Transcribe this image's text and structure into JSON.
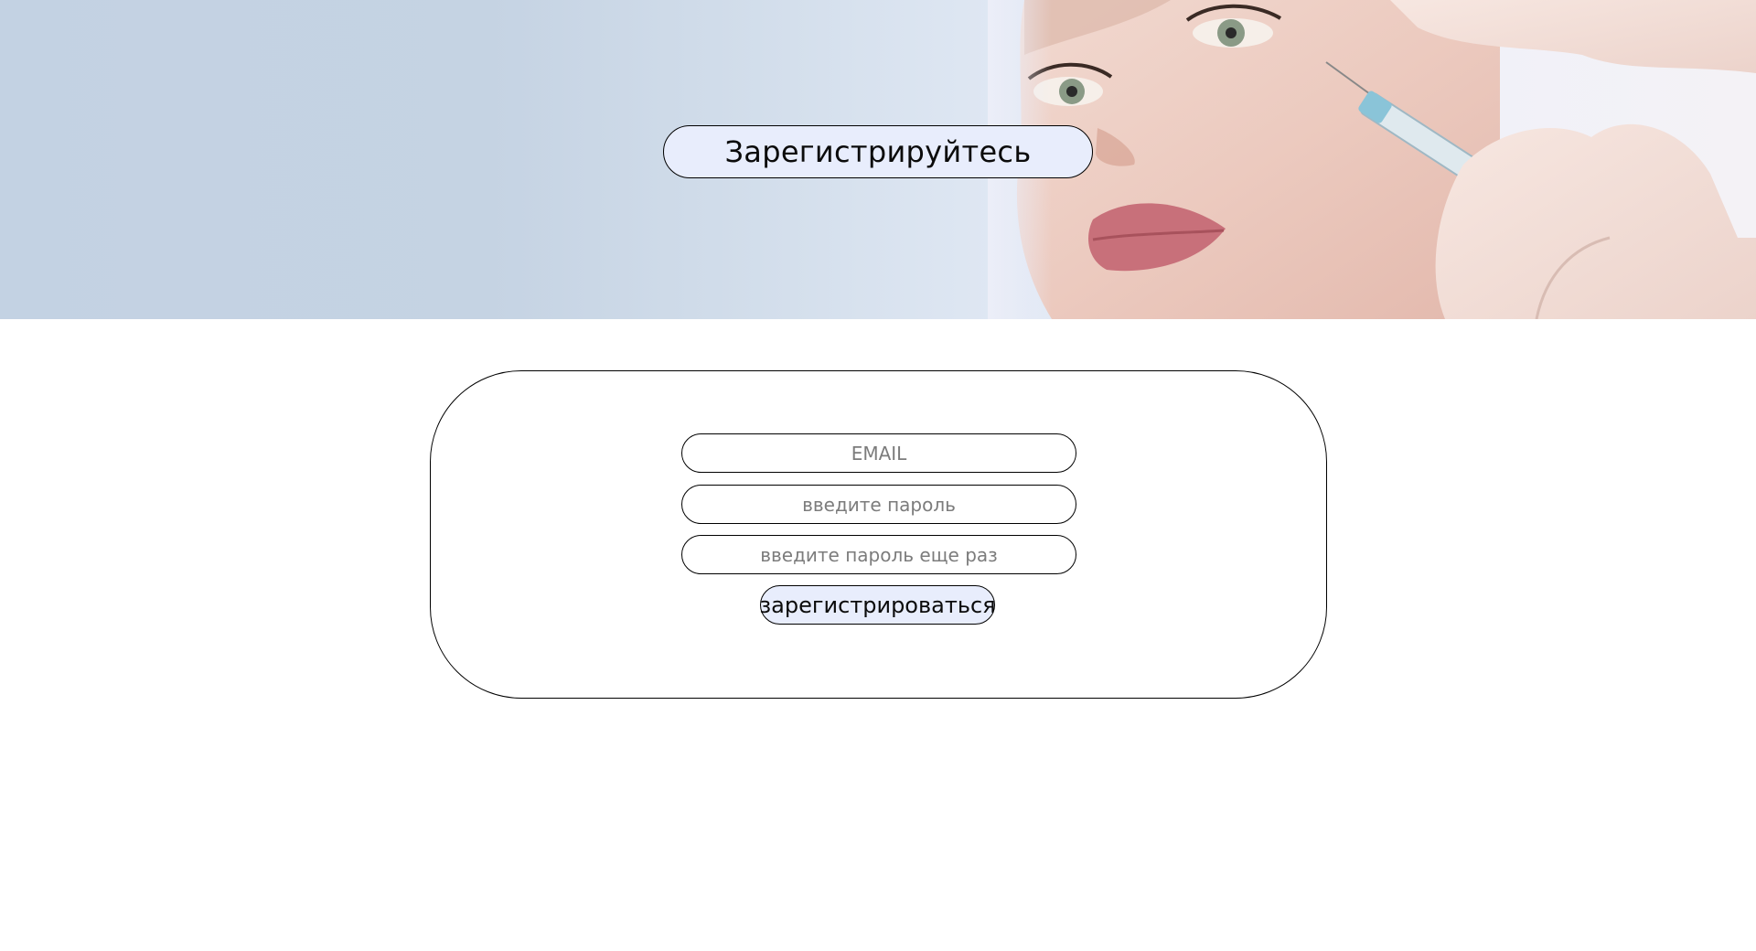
{
  "hero": {
    "title": "Зарегистрируйтесь",
    "image": "cosmetic-injection-face-photo"
  },
  "form": {
    "email_placeholder": "EMAIL",
    "password_placeholder": "введите пароль",
    "password_repeat_placeholder": "введите пароль еще раз",
    "submit_label": "зарегистрироваться"
  },
  "colors": {
    "accent_pill": "#e8edfc",
    "hero_left": "#c3d2e3",
    "hero_right": "#f4f2f6",
    "border": "#000000",
    "placeholder": "#7c7c7c"
  }
}
